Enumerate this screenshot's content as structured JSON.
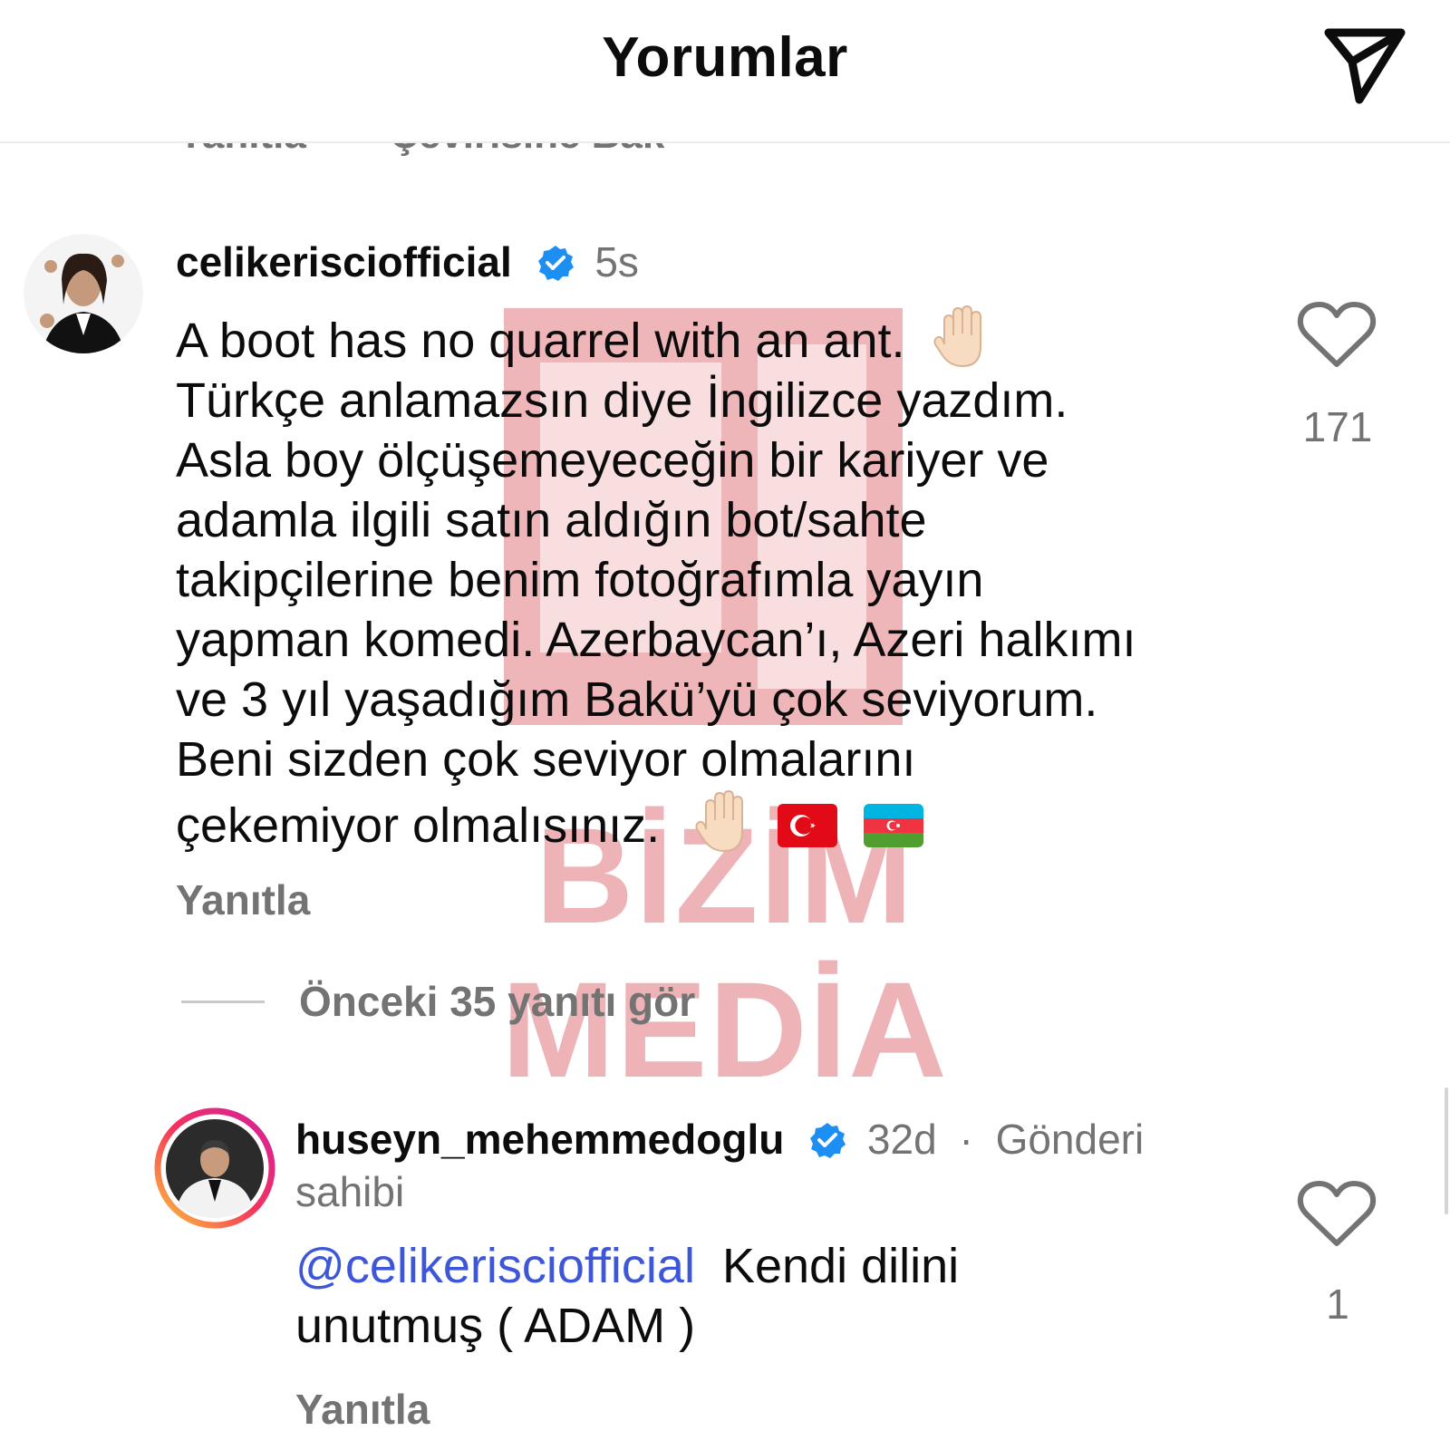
{
  "header": {
    "title": "Yorumlar",
    "share_icon": "send-icon"
  },
  "previous_comment_actions": {
    "reply_label": "Yanıtla",
    "translation_label": "Çevirisine Bak"
  },
  "watermark": {
    "line1": "BİZİM",
    "line2": "MEDİA"
  },
  "comments": [
    {
      "username": "celikerisciofficial",
      "verified": true,
      "time": "5s",
      "lines": [
        "A boot has no quarrel with an ant.",
        "Türkçe anlamazsın diye İngilizce yazdım.",
        "Asla boy ölçüşemeyeceğin bir kariyer ve",
        "adamla ilgili satın aldığın bot/sahte",
        "takipçilerine benim fotoğrafımla yayın",
        "yapman komedi. Azerbaycan’ı, Azeri halkımı",
        "ve 3 yıl yaşadığım Bakü’yü çok seviyorum.",
        "Beni sizden çok seviyor olmalarını",
        "çekemiyor olmalısınız."
      ],
      "emojis": [
        "raised-hand",
        "flag-turkey",
        "flag-azerbaijan"
      ],
      "like_count": "171",
      "reply_label": "Yanıtla"
    },
    {
      "view_replies_label": "Önceki 35 yanıtı gör"
    },
    {
      "username": "huseyn_mehemmedoglu",
      "verified": true,
      "time": "32d",
      "separator": "·",
      "owner_label_1": "Gönderi",
      "owner_label_2": "sahibi",
      "mention": "@celikerisciofficial",
      "line1_rest": "Kendi dilini",
      "line2": "unutmuş ( ADAM )",
      "like_count": "1",
      "reply_label": "Yanıtla"
    }
  ],
  "colors": {
    "text": "#0c0c0c",
    "muted": "#737373",
    "verified": "#1d8ff2",
    "mention": "#3d57d8",
    "watermark": "#e99a9e"
  }
}
